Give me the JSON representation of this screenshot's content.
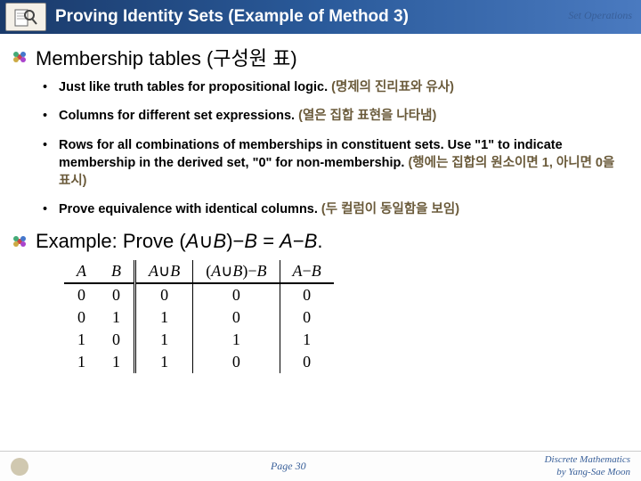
{
  "header": {
    "title": "Proving Identity Sets (Example of Method 3)",
    "right": "Set Operations"
  },
  "section1": {
    "heading": "Membership tables (구성원 표)",
    "bullets": [
      {
        "bold": "Just like truth tables for propositional logic. ",
        "kor": "(명제의 진리표와 유사)"
      },
      {
        "bold": "Columns for different set expressions. ",
        "kor": "(열은 집합 표현을 나타냄)"
      },
      {
        "bold": "Rows for all combinations of memberships in constituent sets. Use \"1\" to indicate membership in the derived set, \"0\" for non-membership. ",
        "kor": "(행에는 집합의 원소이면 1, 아니면 0을 표시)"
      },
      {
        "bold": "Prove equivalence with identical columns. ",
        "kor": "(두 컬럼이 동일함을 보임)"
      }
    ]
  },
  "section2": {
    "heading_pre": "Example: Prove (",
    "A": "A",
    "cup": "∪",
    "B": "B",
    "heading_mid1": ")−",
    "eq": " = ",
    "minus": "−",
    "dot": "."
  },
  "table": {
    "h1": "A",
    "h2": "B",
    "h3a": "A",
    "h3b": "∪",
    "h3c": "B",
    "h4a": "(",
    "h4b": "A",
    "h4c": "∪",
    "h4d": "B",
    "h4e": ")−",
    "h4f": "B",
    "h5a": "A",
    "h5b": "−",
    "h5c": "B",
    "rows": [
      [
        "0",
        "0",
        "0",
        "0",
        "0"
      ],
      [
        "0",
        "1",
        "1",
        "0",
        "0"
      ],
      [
        "1",
        "0",
        "1",
        "1",
        "1"
      ],
      [
        "1",
        "1",
        "1",
        "0",
        "0"
      ]
    ]
  },
  "footer": {
    "page": "Page 30",
    "right1": "Discrete Mathematics",
    "right2": "by Yang-Sae Moon"
  },
  "chart_data": {
    "type": "table",
    "title": "Membership table proving (A∪B)−B = A−B",
    "columns": [
      "A",
      "B",
      "A∪B",
      "(A∪B)−B",
      "A−B"
    ],
    "rows": [
      [
        0,
        0,
        0,
        0,
        0
      ],
      [
        0,
        1,
        1,
        0,
        0
      ],
      [
        1,
        0,
        1,
        1,
        1
      ],
      [
        1,
        1,
        1,
        0,
        0
      ]
    ]
  }
}
